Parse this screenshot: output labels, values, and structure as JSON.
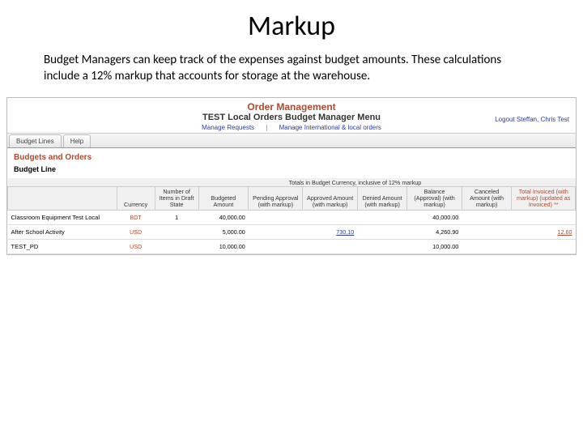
{
  "slide": {
    "title": "Markup",
    "body": "Budget Managers can keep track of the expenses against budget amounts. These calculations include a 12% markup that accounts for storage at the warehouse."
  },
  "app": {
    "header_title": "Order Management",
    "header_subtitle": "TEST Local Orders Budget Manager Menu",
    "link_manage_requests": "Manage Requests",
    "link_manage_intl": "Manage International & local orders",
    "logout_label": "Logout Steffan, Chris Test",
    "tabs": {
      "budget_lines": "Budget Lines",
      "help": "Help"
    },
    "section_title": "Budgets and Orders",
    "sub_title": "Budget Line",
    "table_caption": "Totals in Budget Currency, inclusive of 12% markup",
    "headers": {
      "h0": "",
      "h1": "Currency",
      "h2": "Number of Items in Draft State",
      "h3": "Budgeted Amount",
      "h4": "Pending Approval (with markup)",
      "h5": "Approved Amount (with markup)",
      "h6": "Denied Amount (with markup)",
      "h7": "Balance (Approval) (with markup)",
      "h8": "Canceled Amount (with markup)",
      "h9": "Total Invoiced (with markup) (updated as Invoiced) **"
    },
    "rows": [
      {
        "name": "Classroom Equipment Test Local",
        "currency": "BDT",
        "draft": "1",
        "budgeted": "40,000.00",
        "pending": "",
        "approved": "",
        "denied": "",
        "balance": "40,000.00",
        "canceled": "",
        "invoiced": ""
      },
      {
        "name": "After School Activity",
        "currency": "USD",
        "draft": "",
        "budgeted": "5,000.00",
        "pending": "",
        "approved": "730.10",
        "denied": "",
        "balance": "4,260.90",
        "canceled": "",
        "invoiced": "12.60"
      },
      {
        "name": "TEST_PD",
        "currency": "USD",
        "draft": "",
        "budgeted": "10,000.00",
        "pending": "",
        "approved": "",
        "denied": "",
        "balance": "10,000.00",
        "canceled": "",
        "invoiced": ""
      }
    ]
  }
}
